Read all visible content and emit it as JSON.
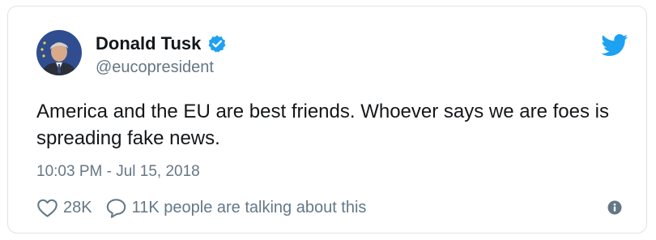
{
  "tweet": {
    "author": {
      "display_name": "Donald Tusk",
      "handle": "@eucopresident",
      "verified": true,
      "avatar": "avatar-photo"
    },
    "text": "America and the EU are best friends. Whoever says we are foes is spreading fake news.",
    "timestamp": "10:03 PM - Jul 15, 2018",
    "likes": "28K",
    "conversation": "11K people are talking about this"
  },
  "icons": {
    "brand": "twitter-bird-icon",
    "like": "heart-icon",
    "reply": "speech-bubble-icon",
    "info": "info-icon",
    "verified": "verified-badge-icon"
  },
  "colors": {
    "brand_blue": "#1da1f2",
    "text": "#14171a",
    "secondary_text": "#657786",
    "border": "#dfe3e6"
  }
}
